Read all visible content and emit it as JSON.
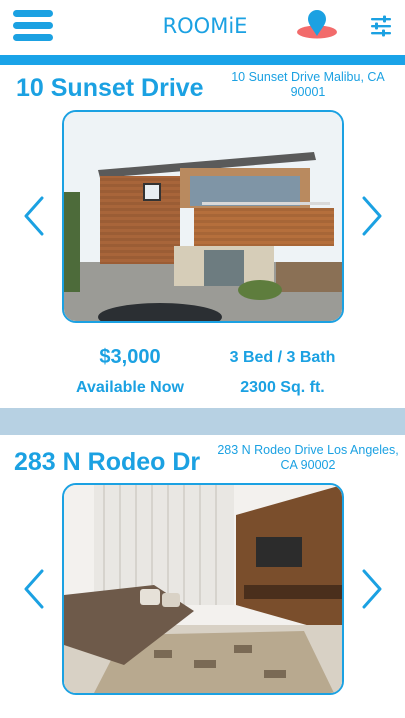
{
  "header": {
    "logo_text": "ROOMiE",
    "menu_icon": "hamburger-menu-icon",
    "location_icon": "location-pin-icon",
    "filter_icon": "sliders-filter-icon"
  },
  "colors": {
    "accent": "#1ba1e2",
    "divider": "#b7d1e3",
    "pin_shadow": "#f26b6b"
  },
  "listings": [
    {
      "title": "10 Sunset Drive",
      "address": "10 Sunset Drive Malibu, CA 90001",
      "price": "$3,000",
      "availability": "Available Now",
      "beds_baths": "3 Bed / 3 Bath",
      "area": "2300 Sq. ft."
    },
    {
      "title": "283 N Rodeo Dr",
      "address": "283 N Rodeo Drive Los Angeles, CA 90002"
    }
  ]
}
